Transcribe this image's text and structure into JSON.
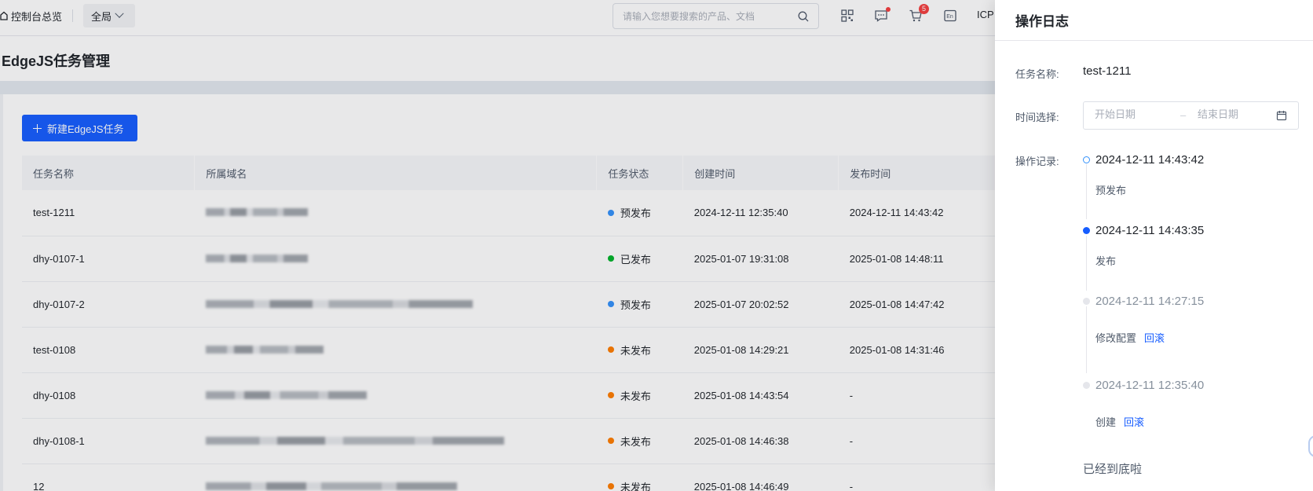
{
  "topbar": {
    "breadcrumb": "控制台总览",
    "scope": "全局",
    "search_placeholder": "请输入您想要搜索的产品、文档",
    "cart_count": "5",
    "icp": "ICP"
  },
  "page": {
    "title": "EdgeJS任务管理",
    "new_button": "新建EdgeJS任务"
  },
  "table": {
    "headers": [
      "任务名称",
      "所属域名",
      "任务状态",
      "创建时间",
      "发布时间"
    ],
    "rows": [
      {
        "name": "test-1211",
        "status": "预发布",
        "status_color": "#3491fa",
        "created": "2024-12-11 12:35:40",
        "published": "2024-12-11 14:43:42"
      },
      {
        "name": "dhy-0107-1",
        "status": "已发布",
        "status_color": "#00b42a",
        "created": "2025-01-07 19:31:08",
        "published": "2025-01-08 14:48:11"
      },
      {
        "name": "dhy-0107-2",
        "status": "预发布",
        "status_color": "#3491fa",
        "created": "2025-01-07 20:02:52",
        "published": "2025-01-08 14:47:42"
      },
      {
        "name": "test-0108",
        "status": "未发布",
        "status_color": "#ff7d00",
        "created": "2025-01-08 14:29:21",
        "published": "2025-01-08 14:31:46"
      },
      {
        "name": "dhy-0108",
        "status": "未发布",
        "status_color": "#ff7d00",
        "created": "2025-01-08 14:43:54",
        "published": "-"
      },
      {
        "name": "dhy-0108-1",
        "status": "未发布",
        "status_color": "#ff7d00",
        "created": "2025-01-08 14:46:38",
        "published": "-"
      },
      {
        "name": "12",
        "status": "未发布",
        "status_color": "#ff7d00",
        "created": "2025-01-08 14:46:49",
        "published": "-"
      }
    ]
  },
  "drawer": {
    "title": "操作日志",
    "task_label": "任务名称:",
    "task_value": "test-1211",
    "time_label": "时间选择:",
    "start_placeholder": "开始日期",
    "range_sep": "–",
    "end_placeholder": "结束日期",
    "records_label": "操作记录:",
    "records": [
      {
        "time": "2024-12-11 14:43:42",
        "action": "预发布",
        "link": ""
      },
      {
        "time": "2024-12-11 14:43:35",
        "action": "发布",
        "link": ""
      },
      {
        "time": "2024-12-11 14:27:15",
        "action": "修改配置",
        "link": "回滚"
      },
      {
        "time": "2024-12-11 12:35:40",
        "action": "创建",
        "link": "回滚"
      }
    ],
    "end_text": "已经到底啦"
  }
}
